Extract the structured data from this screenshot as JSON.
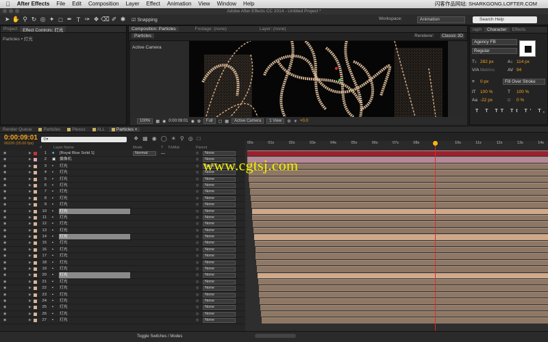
{
  "menubar": {
    "apple": "",
    "app": "After Effects",
    "items": [
      "File",
      "Edit",
      "Composition",
      "Layer",
      "Effect",
      "Animation",
      "View",
      "Window",
      "Help"
    ],
    "right_text": "闪客作品网站: SHARKGONG.LOFTER.COM"
  },
  "window_title": "Adobe After Effects CC 2014 - Untitled Project *",
  "toolbar": {
    "snapping": "Snapping",
    "workspace_label": "Workspace:",
    "workspace_value": "Animation",
    "search_placeholder": "Search Help"
  },
  "left_panel": {
    "tab_project": "Project",
    "tab_effect_controls": "Effect Controls: 灯光",
    "breadcrumb": "Particles • 灯光"
  },
  "comp_panel": {
    "tab_comp": "Composition: Particles",
    "tab_footage": "Footage: (none)",
    "tab_layer": "Layer: (none)",
    "comp_button": "Particles",
    "renderer_label": "Renderer:",
    "renderer_value": "Classic 3D",
    "camera_label": "Active Camera",
    "zoom": "100%",
    "timecode": "0:00:09:01",
    "resolution": "Full",
    "view_camera": "Active Camera",
    "view_layout": "1 View",
    "exposure": "+0.0"
  },
  "character_panel": {
    "tab_graph": "raph",
    "tab_character": "Character",
    "tab_effects": "Effects",
    "font": "Agency FB",
    "style": "Regular",
    "font_size": "282 px",
    "leading": "114 px",
    "kerning": "Metrics",
    "tracking": "94",
    "stroke_width": "0 px",
    "stroke_mode": "Fill Over Stroke",
    "vscale": "100 %",
    "hscale": "100 %",
    "baseline": "-22 px",
    "tsume": "0 %"
  },
  "timeline": {
    "tabs": [
      "Render Queue",
      "Particles",
      "Plexus",
      "ALL",
      "Particles"
    ],
    "tab_colors": [
      "#555555",
      "#c8b25a",
      "#c8b25a",
      "#c8b25a",
      "#c8b25a"
    ],
    "timecode": "0:00:09:01",
    "fps": "00226 (25.00 fps)",
    "col_layer_name": "Layer Name",
    "col_mode": "Mode",
    "col_t": "T",
    "col_trkmat": "TrkMat",
    "col_parent": "Parent",
    "col_hash": "#",
    "ruler_ticks": [
      "00s",
      "01s",
      "02s",
      "03s",
      "04s",
      "05s",
      "06s",
      "07s",
      "08s",
      "",
      "10s",
      "11s",
      "12s",
      "13s",
      "14s"
    ],
    "current_time_seconds": 9.04,
    "toggle_label": "Toggle Switches / Modes",
    "layers": [
      {
        "num": "1",
        "name": "[Royal Blue Solid 1]",
        "icon": "solid",
        "label_color": "#c8323c",
        "mode": "Normal",
        "parent": "None",
        "hl": false,
        "bar_start": 0,
        "bar_color": "#9b2030"
      },
      {
        "num": "2",
        "name": "摄像机",
        "icon": "camera",
        "label_color": "#e0a4b0",
        "mode": "",
        "parent": "None",
        "hl": false,
        "bar_start": 0,
        "bar_color": "#b58898"
      },
      {
        "num": "3",
        "name": "灯光",
        "icon": "light",
        "label_color": "#d8b49a",
        "mode": "",
        "parent": "None",
        "hl": false,
        "bar_start": 0.05,
        "bar_color": ""
      },
      {
        "num": "4",
        "name": "灯光",
        "icon": "light",
        "label_color": "#d8b49a",
        "mode": "",
        "parent": "None",
        "hl": false,
        "bar_start": 0.1,
        "bar_color": ""
      },
      {
        "num": "5",
        "name": "灯光",
        "icon": "light",
        "label_color": "#d8b49a",
        "mode": "",
        "parent": "None",
        "hl": false,
        "bar_start": 0.15,
        "bar_color": ""
      },
      {
        "num": "6",
        "name": "灯光",
        "icon": "light",
        "label_color": "#d8b49a",
        "mode": "",
        "parent": "None",
        "hl": false,
        "bar_start": 0.2,
        "bar_color": ""
      },
      {
        "num": "7",
        "name": "灯光",
        "icon": "light",
        "label_color": "#d8b49a",
        "mode": "",
        "parent": "None",
        "hl": false,
        "bar_start": 0.25,
        "bar_color": ""
      },
      {
        "num": "8",
        "name": "灯光",
        "icon": "light",
        "label_color": "#d8b49a",
        "mode": "",
        "parent": "None",
        "hl": false,
        "bar_start": 0.3,
        "bar_color": ""
      },
      {
        "num": "9",
        "name": "灯光",
        "icon": "light",
        "label_color": "#d8b49a",
        "mode": "",
        "parent": "None",
        "hl": false,
        "bar_start": 0.35,
        "bar_color": ""
      },
      {
        "num": "10",
        "name": "灯光",
        "icon": "light",
        "label_color": "#d8b49a",
        "mode": "",
        "parent": "None",
        "hl": true,
        "bar_start": 0.4,
        "bar_color": ""
      },
      {
        "num": "11",
        "name": "灯光",
        "icon": "light",
        "label_color": "#d8b49a",
        "mode": "",
        "parent": "None",
        "hl": false,
        "bar_start": 0.45,
        "bar_color": ""
      },
      {
        "num": "12",
        "name": "灯光",
        "icon": "light",
        "label_color": "#d8b49a",
        "mode": "",
        "parent": "None",
        "hl": false,
        "bar_start": 0.5,
        "bar_color": ""
      },
      {
        "num": "13",
        "name": "灯光",
        "icon": "light",
        "label_color": "#d8b49a",
        "mode": "",
        "parent": "None",
        "hl": false,
        "bar_start": 0.55,
        "bar_color": ""
      },
      {
        "num": "14",
        "name": "灯光",
        "icon": "light",
        "label_color": "#d8b49a",
        "mode": "",
        "parent": "None",
        "hl": true,
        "bar_start": 0.6,
        "bar_color": ""
      },
      {
        "num": "15",
        "name": "灯光",
        "icon": "light",
        "label_color": "#d8b49a",
        "mode": "",
        "parent": "None",
        "hl": false,
        "bar_start": 0.65,
        "bar_color": ""
      },
      {
        "num": "16",
        "name": "灯光",
        "icon": "light",
        "label_color": "#d8b49a",
        "mode": "",
        "parent": "None",
        "hl": false,
        "bar_start": 0.7,
        "bar_color": ""
      },
      {
        "num": "17",
        "name": "灯光",
        "icon": "light",
        "label_color": "#d8b49a",
        "mode": "",
        "parent": "None",
        "hl": false,
        "bar_start": 0.75,
        "bar_color": ""
      },
      {
        "num": "18",
        "name": "灯光",
        "icon": "light",
        "label_color": "#d8b49a",
        "mode": "",
        "parent": "None",
        "hl": false,
        "bar_start": 0.8,
        "bar_color": ""
      },
      {
        "num": "19",
        "name": "灯光",
        "icon": "light",
        "label_color": "#d8b49a",
        "mode": "",
        "parent": "None",
        "hl": false,
        "bar_start": 0.85,
        "bar_color": ""
      },
      {
        "num": "20",
        "name": "灯光",
        "icon": "light",
        "label_color": "#d8b49a",
        "mode": "",
        "parent": "None",
        "hl": true,
        "bar_start": 0.9,
        "bar_color": ""
      },
      {
        "num": "21",
        "name": "灯光",
        "icon": "light",
        "label_color": "#d8b49a",
        "mode": "",
        "parent": "None",
        "hl": false,
        "bar_start": 0.95,
        "bar_color": ""
      },
      {
        "num": "22",
        "name": "灯光",
        "icon": "light",
        "label_color": "#d8b49a",
        "mode": "",
        "parent": "None",
        "hl": false,
        "bar_start": 1.0,
        "bar_color": ""
      },
      {
        "num": "23",
        "name": "灯光",
        "icon": "light",
        "label_color": "#d8b49a",
        "mode": "",
        "parent": "None",
        "hl": false,
        "bar_start": 1.05,
        "bar_color": ""
      },
      {
        "num": "24",
        "name": "灯光",
        "icon": "light",
        "label_color": "#d8b49a",
        "mode": "",
        "parent": "None",
        "hl": false,
        "bar_start": 1.1,
        "bar_color": ""
      },
      {
        "num": "25",
        "name": "灯光",
        "icon": "light",
        "label_color": "#d8b49a",
        "mode": "",
        "parent": "None",
        "hl": false,
        "bar_start": 1.15,
        "bar_color": ""
      },
      {
        "num": "26",
        "name": "灯光",
        "icon": "light",
        "label_color": "#d8b49a",
        "mode": "",
        "parent": "None",
        "hl": false,
        "bar_start": 1.2,
        "bar_color": ""
      },
      {
        "num": "27",
        "name": "灯光",
        "icon": "light",
        "label_color": "#d8b49a",
        "mode": "",
        "parent": "None",
        "hl": false,
        "bar_start": 1.25,
        "bar_color": ""
      }
    ],
    "bar_default_color": "#8e7865",
    "bar_hl_color": "#cfa98a"
  },
  "watermark": "www.cgtsj.com",
  "colors": {
    "accent": "#f5a623",
    "cti": "#e2262b",
    "watermark": "#f6f100"
  }
}
